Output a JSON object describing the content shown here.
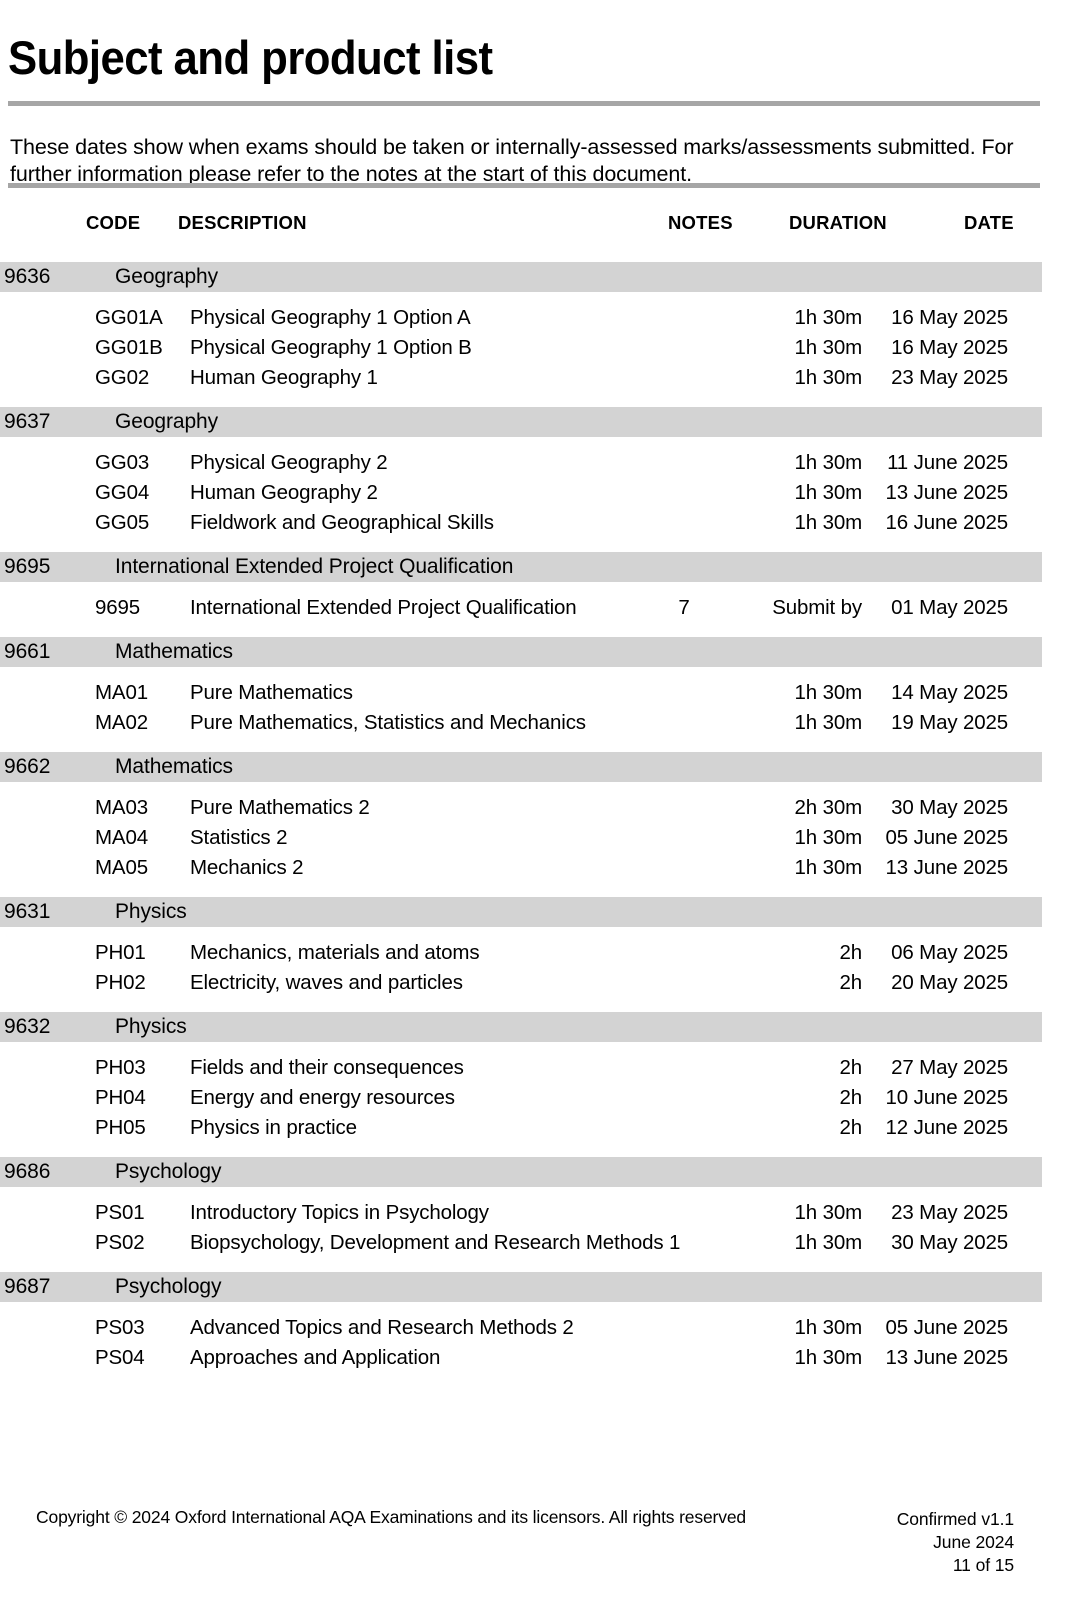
{
  "document": {
    "title": "Subject and product list",
    "intro": "These dates show when exams should be taken or internally-assessed marks/assessments submitted.  For further information please refer to the notes at the start of this document."
  },
  "columns": {
    "code": "CODE",
    "description": "DESCRIPTION",
    "notes": "NOTES",
    "duration": "DURATION",
    "date": "DATE"
  },
  "colors": {
    "section_band": "#d3d3d3",
    "rule": "#a6a6a6",
    "text": "#000000",
    "background": "#ffffff"
  },
  "sections": [
    {
      "code": "9636",
      "name": "Geography",
      "rows": [
        {
          "code": "GG01A",
          "description": "Physical Geography 1 Option A",
          "notes": "",
          "duration": "1h 30m",
          "date": "16 May 2025"
        },
        {
          "code": "GG01B",
          "description": "Physical Geography 1 Option B",
          "notes": "",
          "duration": "1h 30m",
          "date": "16 May 2025"
        },
        {
          "code": "GG02",
          "description": "Human Geography 1",
          "notes": "",
          "duration": "1h 30m",
          "date": "23 May 2025"
        }
      ]
    },
    {
      "code": "9637",
      "name": "Geography",
      "rows": [
        {
          "code": "GG03",
          "description": "Physical Geography 2",
          "notes": "",
          "duration": "1h 30m",
          "date": "11 June 2025"
        },
        {
          "code": "GG04",
          "description": "Human Geography 2",
          "notes": "",
          "duration": "1h 30m",
          "date": "13 June 2025"
        },
        {
          "code": "GG05",
          "description": "Fieldwork and Geographical Skills",
          "notes": "",
          "duration": "1h 30m",
          "date": "16 June 2025"
        }
      ]
    },
    {
      "code": "9695",
      "name": "International Extended Project Qualification",
      "rows": [
        {
          "code": "9695",
          "description": "International Extended Project Qualification",
          "notes": "7",
          "duration": "Submit by",
          "date": "01 May 2025"
        }
      ]
    },
    {
      "code": "9661",
      "name": "Mathematics",
      "rows": [
        {
          "code": "MA01",
          "description": "Pure Mathematics",
          "notes": "",
          "duration": "1h 30m",
          "date": "14 May 2025"
        },
        {
          "code": "MA02",
          "description": "Pure Mathematics, Statistics and Mechanics",
          "notes": "",
          "duration": "1h 30m",
          "date": "19 May 2025"
        }
      ]
    },
    {
      "code": "9662",
      "name": "Mathematics",
      "rows": [
        {
          "code": "MA03",
          "description": "Pure Mathematics 2",
          "notes": "",
          "duration": "2h 30m",
          "date": "30 May 2025"
        },
        {
          "code": "MA04",
          "description": "Statistics 2",
          "notes": "",
          "duration": "1h 30m",
          "date": "05 June 2025"
        },
        {
          "code": "MA05",
          "description": "Mechanics 2",
          "notes": "",
          "duration": "1h 30m",
          "date": "13 June 2025"
        }
      ]
    },
    {
      "code": "9631",
      "name": "Physics",
      "rows": [
        {
          "code": "PH01",
          "description": "Mechanics, materials and atoms",
          "notes": "",
          "duration": "2h",
          "date": "06 May 2025"
        },
        {
          "code": "PH02",
          "description": "Electricity, waves and particles",
          "notes": "",
          "duration": "2h",
          "date": "20 May 2025"
        }
      ]
    },
    {
      "code": "9632",
      "name": "Physics",
      "rows": [
        {
          "code": "PH03",
          "description": "Fields and their consequences",
          "notes": "",
          "duration": "2h",
          "date": "27 May 2025"
        },
        {
          "code": "PH04",
          "description": "Energy and energy resources",
          "notes": "",
          "duration": "2h",
          "date": "10 June 2025"
        },
        {
          "code": "PH05",
          "description": "Physics in practice",
          "notes": "",
          "duration": "2h",
          "date": "12 June 2025"
        }
      ]
    },
    {
      "code": "9686",
      "name": "Psychology",
      "rows": [
        {
          "code": "PS01",
          "description": "Introductory Topics in Psychology",
          "notes": "",
          "duration": "1h 30m",
          "date": "23 May 2025"
        },
        {
          "code": "PS02",
          "description": "Biopsychology, Development and Research Methods 1",
          "notes": "",
          "duration": "1h 30m",
          "date": "30 May 2025"
        }
      ]
    },
    {
      "code": "9687",
      "name": "Psychology",
      "rows": [
        {
          "code": "PS03",
          "description": "Advanced Topics and Research Methods 2",
          "notes": "",
          "duration": "1h 30m",
          "date": "05 June 2025"
        },
        {
          "code": "PS04",
          "description": "Approaches and Application",
          "notes": "",
          "duration": "1h 30m",
          "date": "13 June 2025"
        }
      ]
    }
  ],
  "footer": {
    "copyright": "Copyright © 2024 Oxford International AQA Examinations and its licensors. All rights reserved",
    "version": "Confirmed v1.1",
    "date": "June 2024",
    "page": "11 of 15"
  }
}
